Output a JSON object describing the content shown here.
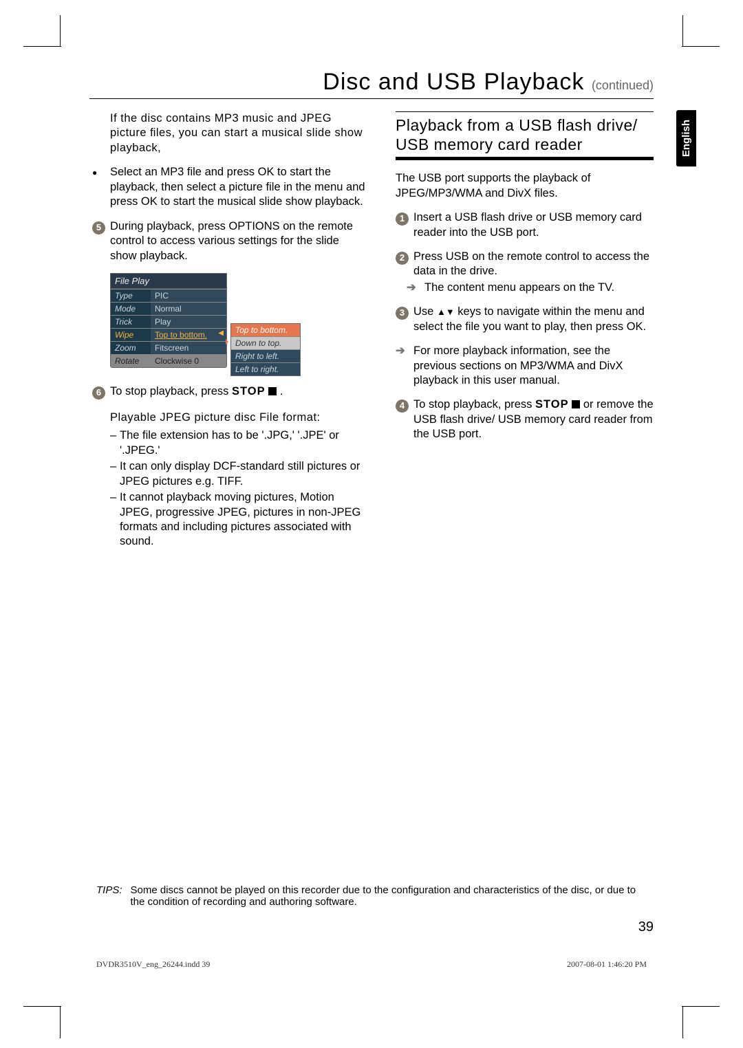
{
  "header": {
    "title": "Disc and USB Playback",
    "sub": "(continued)"
  },
  "language_tab": "English",
  "left": {
    "intro": "If the disc contains MP3 music and JPEG picture ﬁles, you can start a musical slide show playback,",
    "step_bullet": "Select an MP3 file and press OK to start the playback, then select a picture file in the menu and press OK to start the musical slide show playback.",
    "step5_num": "5",
    "step5": "During playback, press OPTIONS on the remote control to access various settings for the slide show playback.",
    "step6_num": "6",
    "step6_a": "To stop playback, press ",
    "step6_b": "STOP",
    "step6_c": ".",
    "subheading": "Playable JPEG picture disc File format:",
    "fb1": "The file extension has to be '.JPG,' '.JPE' or '.JPEG.'",
    "fb2": "It can only display DCF-standard still pictures or JPEG pictures e.g. TIFF.",
    "fb3": "It cannot playback moving pictures, Motion JPEG, progressive JPEG, pictures in non-JPEG formats and including pictures associated with sound."
  },
  "menu": {
    "head": "File Play",
    "r1k": "Type",
    "r1v": "PIC",
    "r2k": "Mode",
    "r2v": "Normal",
    "r3k": "Trick",
    "r3v": "Play",
    "r4k": "Wipe",
    "r4v": "Top to bottom.",
    "r5k": "Zoom",
    "r5v": "Fitscreen",
    "r6k": "Rotate",
    "r6v": "Clockwise 0",
    "sub1": "Top to bottom.",
    "sub2": "Down to top.",
    "sub3": "Right to left.",
    "sub4": "Left to right."
  },
  "right": {
    "title": "Playback from a USB ﬂash drive/ USB memory card reader",
    "intro": "The USB port supports the playback of JPEG/MP3/WMA and DivX files.",
    "s1_num": "1",
    "s1": "Insert a USB flash drive or USB memory card reader into the USB port.",
    "s2_num": "2",
    "s2": "Press USB on the remote control to access the data in the drive.",
    "s2_arrow": "The content menu appears on the TV.",
    "s3_num": "3",
    "s3_a": "Use ",
    "s3_b": " keys to navigate within the menu and select the file you want to play, then press OK.",
    "s3_arrow": "For more playback information, see the previous sections on MP3/WMA and DivX playback in this user manual.",
    "s4_num": "4",
    "s4_a": "To stop playback, press ",
    "s4_b": "STOP",
    "s4_c": " or remove the USB flash drive/ USB memory card reader from the USB port."
  },
  "tips_label": "TIPS:",
  "tips_body": "Some discs cannot be played on this recorder due to the configuration and characteristics of the disc, or due to the condition of recording and authoring software.",
  "page_number": "39",
  "footer": {
    "file": "DVDR3510V_eng_26244.indd   39",
    "date": "2007-08-01   1:46:20 PM"
  }
}
